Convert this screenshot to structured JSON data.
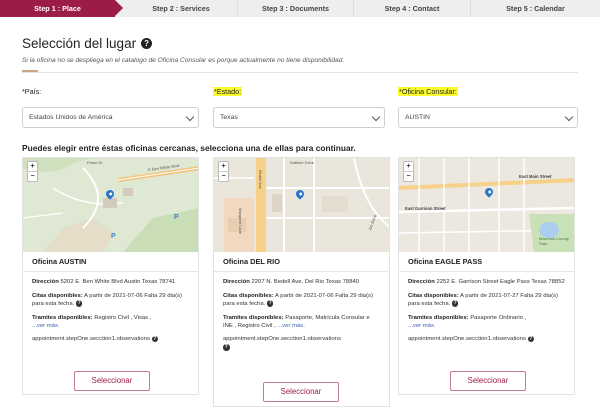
{
  "steps": [
    {
      "label": "Step 1 : Place",
      "active": true
    },
    {
      "label": "Step 2 : Services"
    },
    {
      "label": "Step 3 : Documents"
    },
    {
      "label": "Step 4 : Contact"
    },
    {
      "label": "Step 5 : Calendar"
    }
  ],
  "page": {
    "title": "Selección del lugar",
    "subtitle": "Si la oficina no se despliega en el catalogo de Oficina Consular es porque actualmente no tiene disponibilidad.",
    "nearby_text": "Puedes elegir entre éstas oficinas cercanas, selecciona una de ellas para continuar."
  },
  "fields": {
    "pais": {
      "label": "*País:",
      "value": "Estados Unidos de América"
    },
    "estado": {
      "label": "*Estado:",
      "value": "Texas"
    },
    "oficina": {
      "label": "*Oficina Consular:",
      "value": "AUSTIN"
    }
  },
  "offices": [
    {
      "name": "Oficina AUSTIN",
      "address_label": "Dirección",
      "address": "5202 E. Ben White Blvd Austin Texas 78741",
      "citas_label": "Citas disponibles:",
      "citas": "A partir de 2021-07-06 Falta 29 dia(s) para esta fecha.",
      "tramites_label": "Tramites disponibles:",
      "tramites": "Registro Civil , Visas ,",
      "more": "...ver más.",
      "observations": "appointment.stepOne.secction1.observations",
      "button": "Seleccionar",
      "map_labels": [
        "Foton Dr",
        "E Ben White Blvd",
        "P",
        "P"
      ]
    },
    {
      "name": "Oficina DEL RIO",
      "address_label": "Dirección",
      "address": "2207 N. Bedell Ave. Del Rio Texas 78840",
      "citas_label": "Citas disponibles:",
      "citas": "A partir de 2021-07-06 Falta 29 dia(s) para esta fecha.",
      "tramites_label": "Tramites disponibles:",
      "tramites": "Pasaporte, Matrícula Consular e INE , Registro Civil ,",
      "more": "...ver más.",
      "observations": "appointment.stepOne.secction1.observations",
      "button": "Seleccionar",
      "map_labels": [
        "Bedell Ave",
        "Kathlee Drive",
        "Jim Drive",
        "Margaret Lane"
      ]
    },
    {
      "name": "Oficina EAGLE PASS",
      "address_label": "Dirección",
      "address": "2252 E. Garrison Street Eagle Pass Texas 78852",
      "citas_label": "Citas disponibles:",
      "citas": "A partir de 2021-07-27 Falta 29 dia(s) para esta fecha.",
      "tramites_label": "Tramites disponibles:",
      "tramites": "Pasaporte Ordinario ,",
      "more": "...ver más.",
      "observations": "appointment.stepOne.secction1.observations",
      "button": "Seleccionar",
      "map_labels": [
        "East Main Street",
        "East Garrison Street",
        "Maverick County Park"
      ]
    }
  ]
}
